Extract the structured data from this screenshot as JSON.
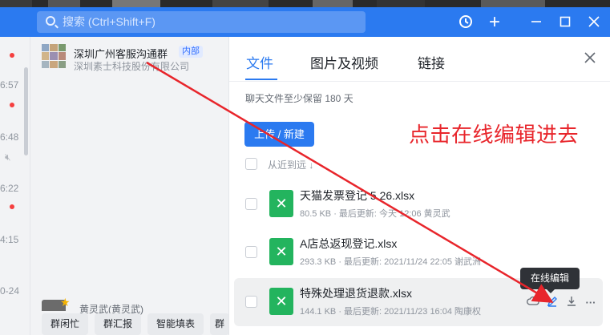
{
  "titlebar": {
    "search_placeholder": "搜索 (Ctrl+Shift+F)",
    "history_icon": "history-icon",
    "add_icon": "plus-icon"
  },
  "left_times": [
    "6:57",
    "6:48",
    "6:22",
    "4:15",
    "0-24"
  ],
  "chat": {
    "title": "深圳广州客服沟通群",
    "tag": "内部",
    "subtitle": "深圳素士科技股份有限公司",
    "sender": "黄灵武(黄灵武)",
    "chips": [
      "群闲忙",
      "群汇报",
      "智能填表",
      "群"
    ]
  },
  "panel": {
    "tabs": [
      "文件",
      "图片及视频",
      "链接"
    ],
    "retention": "聊天文件至少保留 180 天",
    "upload_label": "上传 / 新建",
    "sort_label": "从近到远 ↓",
    "annotation": "点击在线编辑进去",
    "tooltip": "在线编辑",
    "files": [
      {
        "name": "天猫发票登记 5.26.xlsx",
        "meta": "80.5 KB  ·  最后更新: 今天 12:06  黄灵武"
      },
      {
        "name": "A店总返现登记.xlsx",
        "meta": "293.3 KB  ·  最后更新: 2021/11/24 22:05  谢武洲"
      },
      {
        "name": "特殊处理退货退款.xlsx",
        "meta": "144.1 KB  ·  最后更新: 2021/11/23 16:04  陶康权"
      }
    ]
  },
  "colors": {
    "accent": "#2b7af0",
    "annotation_red": "#e8252b",
    "excel_green": "#23b45e"
  }
}
